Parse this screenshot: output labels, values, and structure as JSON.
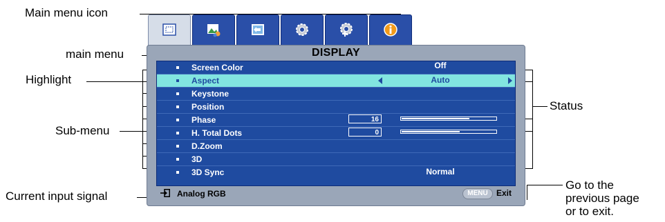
{
  "callouts": {
    "main_menu_icon": "Main menu icon",
    "main_menu": "main menu",
    "highlight": "Highlight",
    "sub_menu": "Sub-menu",
    "current_input_signal": "Current input signal",
    "status": "Status",
    "go_back_line1": "Go to the",
    "go_back_line2": "previous page",
    "go_back_line3": "or to exit."
  },
  "tabs": [
    {
      "icon": "display-icon",
      "active": true
    },
    {
      "icon": "picture-icon",
      "active": false
    },
    {
      "icon": "source-icon",
      "active": false
    },
    {
      "icon": "system-setup-basic-icon",
      "active": false
    },
    {
      "icon": "system-setup-advanced-icon",
      "active": false
    },
    {
      "icon": "information-icon",
      "active": false
    }
  ],
  "menu": {
    "title": "DISPLAY",
    "items": [
      {
        "label": "Screen Color",
        "value": "Off"
      },
      {
        "label": "Aspect",
        "value": "Auto",
        "highlighted": true
      },
      {
        "label": "Keystone",
        "value": ""
      },
      {
        "label": "Position",
        "value": ""
      },
      {
        "label": "Phase",
        "number": "16",
        "level": 0.72
      },
      {
        "label": "H. Total Dots",
        "number": "0",
        "level": 0.62
      },
      {
        "label": "D.Zoom",
        "value": ""
      },
      {
        "label": "3D",
        "value": ""
      },
      {
        "label": "3D Sync",
        "value": "Normal"
      }
    ]
  },
  "footer": {
    "input_signal": "Analog RGB",
    "menu_key": "MENU",
    "exit_label": "Exit"
  },
  "colors": {
    "menu_body": "#1f4ba0",
    "highlight": "#82e5e0",
    "frame": "#9aa6b8"
  }
}
